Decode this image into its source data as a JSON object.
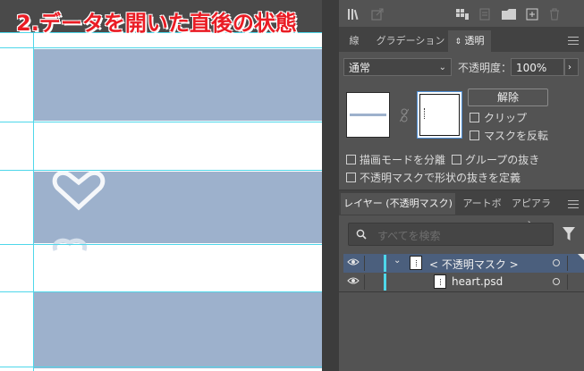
{
  "caption": "2.データを開いた直後の状態",
  "colors": {
    "caption": "#ea1c24",
    "stripe": "#9db1cc",
    "guide": "#4ed7ea",
    "selected_row": "#4b5f7d"
  },
  "toolbar_icons": [
    "library-icon",
    "export-icon",
    "grid-icon",
    "page-icon",
    "folder-icon",
    "new-layer-icon",
    "trash-icon"
  ],
  "tabs": {
    "stroke": "線",
    "gradient": "グラデーション",
    "transparency": "透明"
  },
  "transparency": {
    "blend_mode": "通常",
    "opacity_label": "不透明度：",
    "opacity_value": "100%",
    "release_button": "解除",
    "clip_label": "クリップ",
    "invert_mask_label": "マスクを反転",
    "isolate_blending_label": "描画モードを分離",
    "knockout_group_label": "グループの抜き",
    "opacity_mask_define_label": "不透明マスクで形状の抜きを定義"
  },
  "layers_panel": {
    "tabs": {
      "layers": "レイヤー (不透明マスク)",
      "artboards": "アートボー",
      "appearance": "アピアラン"
    },
    "search_placeholder": "すべてを検索",
    "rows": [
      {
        "name": "< 不透明マスク >"
      },
      {
        "name": "heart.psd"
      }
    ]
  }
}
